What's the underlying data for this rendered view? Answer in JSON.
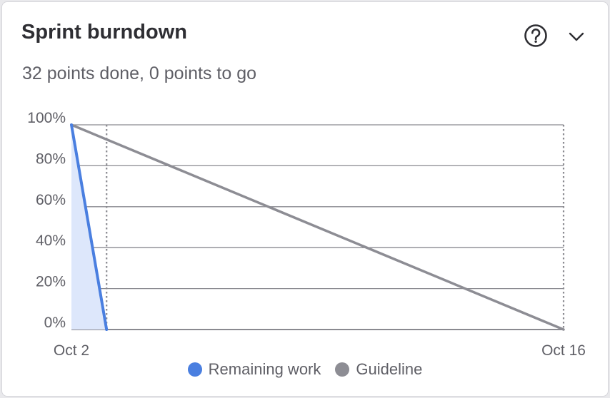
{
  "card": {
    "title": "Sprint burndown",
    "subtitle": "32 points done, 0 points to go"
  },
  "icons": {
    "help": "help-circle-icon",
    "collapse": "chevron-down-icon"
  },
  "colors": {
    "remaining": "#4a7fe0",
    "remaining_fill": "#dde7fb",
    "guideline": "#8d8d94",
    "grid": "#8a8a90",
    "text": "#5f5f66"
  },
  "chart_data": {
    "type": "line",
    "title": "",
    "xlabel": "",
    "ylabel": "",
    "x_ticks": [
      "Oct 2",
      "Oct 16"
    ],
    "y_ticks": [
      "100%",
      "80%",
      "60%",
      "40%",
      "20%",
      "0%"
    ],
    "ylim": [
      0,
      100
    ],
    "xlim": [
      "Oct 2",
      "Oct 16"
    ],
    "grid": true,
    "legend": "bottom",
    "series": [
      {
        "name": "Remaining work",
        "x": [
          "Oct 2",
          "Oct 3"
        ],
        "values": [
          100,
          0
        ],
        "area": true
      },
      {
        "name": "Guideline",
        "x": [
          "Oct 2",
          "Oct 16"
        ],
        "values": [
          100,
          0
        ]
      }
    ],
    "markers": [
      {
        "x": "Oct 3",
        "style": "dotted"
      },
      {
        "x": "Oct 16",
        "style": "dotted"
      }
    ]
  }
}
